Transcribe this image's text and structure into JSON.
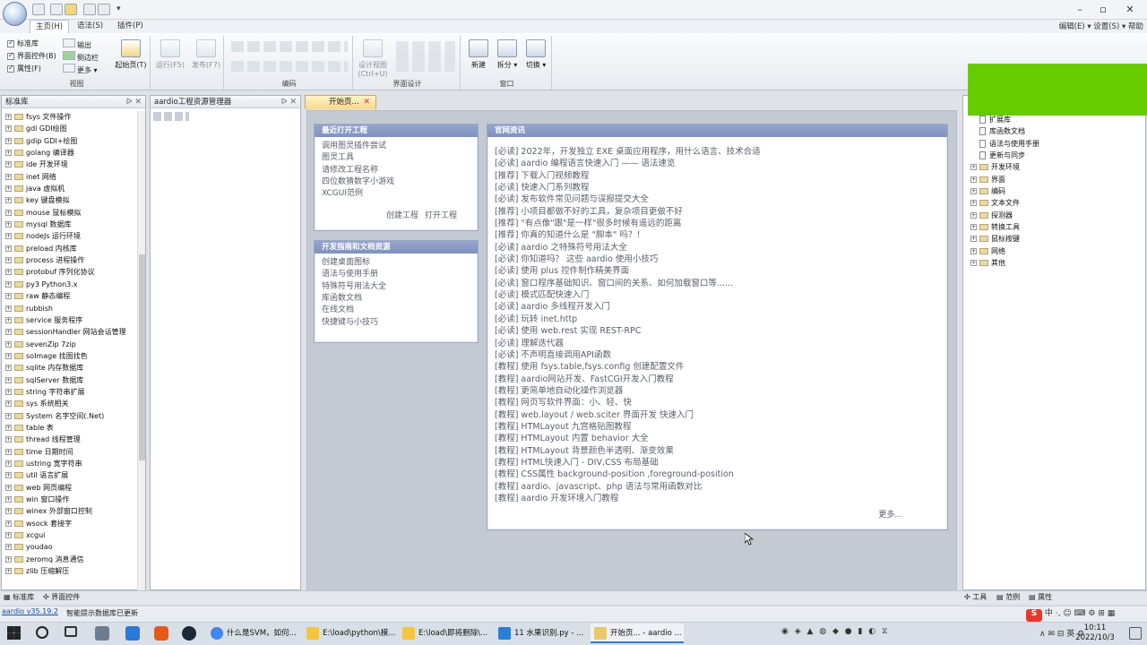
{
  "ribbon": {
    "tabs": [
      "主页(H)",
      "语法(S)",
      "插件(P)"
    ],
    "menu_right": "编辑(E) ▾  设置(S) ▾  帮助",
    "view_group": {
      "checks": [
        "标准库",
        "界面控件(B)",
        "属性(F)"
      ],
      "right_items": [
        "输出",
        "侧边栏",
        "更多"
      ],
      "start_page": "起始页(T)",
      "label": "视图"
    },
    "run_label": "运行(F5)",
    "publish_label": "发布(F7)",
    "edit_group_label": "编码",
    "design_label": "设计视图\n(Ctrl+U)",
    "design_group_label": "界面设计",
    "window_group": {
      "new": "新建",
      "split": "拆分",
      "switch": "切换",
      "label": "窗口"
    }
  },
  "left_panel": {
    "title": "标准库",
    "items": [
      "fsys 文件操作",
      "gdi GDI绘图",
      "gdip GDI+绘图",
      "golang 编译器",
      "ide 开发环境",
      "inet 网络",
      "java 虚拟机",
      "key 键盘模拟",
      "mouse 鼠标模拟",
      "mysql 数据库",
      "nodeJs 运行环境",
      "preload 内核库",
      "process 进程操作",
      "protobuf 序列化协议",
      "py3 Python3.x",
      "raw 静态编程",
      "rubbish",
      "service 服务程序",
      "sessionHandler 网站会话管理",
      "sevenZip 7zip",
      "soImage 找图找色",
      "sqlite 内存数据库",
      "sqlServer 数据库",
      "string 字符串扩展",
      "sys 系统相关",
      "System 名字空间(.Net)",
      "table 表",
      "thread 线程管理",
      "time 日期时间",
      "ustring 宽字符串",
      "util 语言扩展",
      "web 网页编程",
      "win 窗口操作",
      "winex 外部窗口控制",
      "wsock 套接字",
      "xcgui",
      "youdao",
      "zeromq 消息通信",
      "zlib 压缩解压"
    ]
  },
  "project_panel": {
    "title": "aardio工程资源管理器"
  },
  "doc_tab": "开始页...",
  "recent": {
    "title": "最近打开工程",
    "items": [
      "调用图灵插件尝试",
      "图灵工具",
      "请修改工程名称",
      "四位数猜数字小游戏",
      "XCGUI范例"
    ],
    "create": "创建工程",
    "open": "打开工程"
  },
  "guide": {
    "title": "开发指南和文档资源",
    "items": [
      "创建桌面图标",
      "语法与使用手册",
      "特殊符号用法大全",
      "库函数文档",
      "在线文档",
      "快捷键与小技巧"
    ]
  },
  "news": {
    "title": "官网资讯",
    "items": [
      "[必读] 2022年，开发独立 EXE 桌面应用程序，用什么语言、技术合适",
      "[必读] aardio 编程语言快速入门 —— 语法速览",
      "[推荐] 下载入门视频教程",
      "[必读] 快速入门系列教程",
      "[必读] 发布软件常见问题与误报提交大全",
      "[推荐] 小项目都做不好的工具，复杂项目更做不好",
      "[推荐] \"有点像\"跟\"是一样\"很多时候有遥远的距离",
      "[推荐] 你真的知道什么是 \"脚本\" 吗？！",
      "[必读] aardio 之特殊符号用法大全",
      "[必读] 你知道吗？ 这些 aardio 使用小技巧",
      "[必读] 使用 plus 控件制作精美界面",
      "[必读] 窗口程序基础知识、窗口间的关系、如何加载窗口等......",
      "[必读] 模式匹配快速入门",
      "[必读] aardio 多线程开发入门",
      "[必读] 玩转 inet.http",
      "[必读] 使用 web.rest 实现 REST-RPC",
      "[必读] 理解迭代器",
      "[必读] 不声明直接调用API函数",
      "[教程] 使用 fsys.table,fsys.config 创建配置文件",
      "[教程] aardio网站开发、FastCGI开发入门教程",
      "[教程] 更简单地自动化操作浏览器",
      "[教程] 网页写软件界面：小、轻、快",
      "[教程] web.layout / web.sciter 界面开发 快速入门",
      "[教程] HTMLayout 九宫格贴图教程",
      "[教程] HTMLayout 内置 behavior 大全",
      "[教程] HTMLayout 背景颜色半透明、渐变效果",
      "[教程] HTML快速入门 - DIV,CSS 布局基础",
      "[教程] CSS属性 background-position ,foreground-position",
      "[教程] aardio、javascript、php 语法与常用函数对比",
      "[教程] aardio 开发环境入门教程"
    ],
    "more": "更多..."
  },
  "right_panel": {
    "items": [
      "扩展库",
      "库函数文档",
      "语法与使用手册",
      "更新与同步"
    ],
    "folders": [
      "开发环境",
      "界面",
      "编码",
      "文本文件",
      "探测器",
      "转换工具",
      "鼠标按键",
      "网络",
      "其他"
    ]
  },
  "bottom_tabs": {
    "left": [
      "标准库",
      "界面控件"
    ],
    "right": [
      "工具",
      "范例",
      "属性"
    ]
  },
  "status": {
    "version": "aardio v35.19.2",
    "message": "智能提示数据库已更新"
  },
  "taskbar": {
    "tasks": [
      "什么是SVM，如何...",
      "E:\\load\\python\\模...",
      "E:\\load\\即将删除\\...",
      "11 水果识别.py - ...",
      "开始页... - aardio ..."
    ],
    "time": "10:11",
    "date": "2022/10/3"
  }
}
